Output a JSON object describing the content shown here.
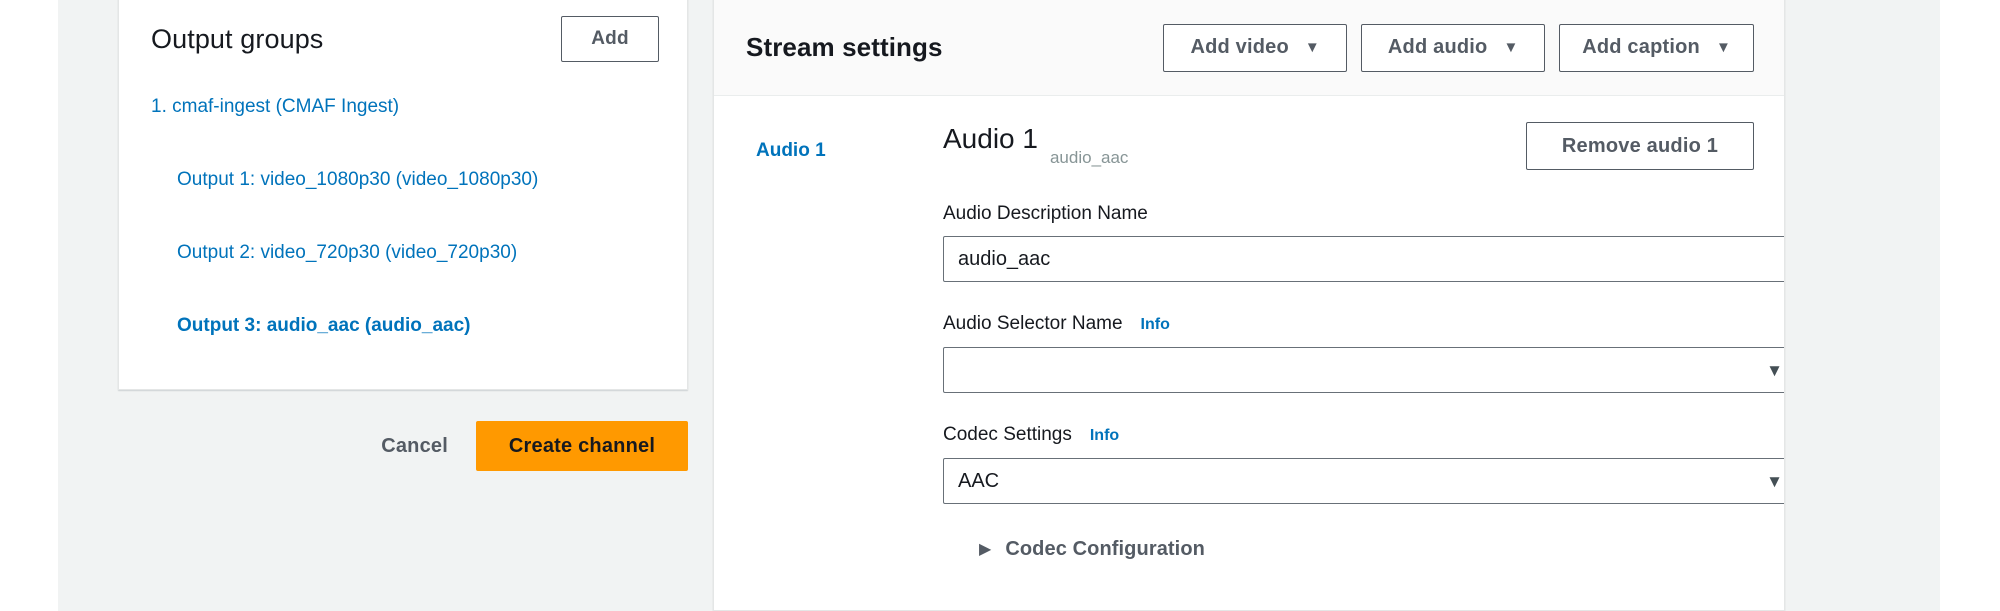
{
  "output_groups": {
    "title": "Output groups",
    "add_button": "Add",
    "groups": [
      {
        "label": "1. cmaf-ingest (CMAF Ingest)",
        "selected": false,
        "outputs": [
          {
            "label": "Output 1: video_1080p30 (video_1080p30)",
            "selected": false
          },
          {
            "label": "Output 2: video_720p30 (video_720p30)",
            "selected": false
          },
          {
            "label": "Output 3: audio_aac (audio_aac)",
            "selected": true
          }
        ]
      }
    ],
    "cancel_button": "Cancel",
    "create_button": "Create channel"
  },
  "stream_settings": {
    "title": "Stream settings",
    "header_buttons": [
      {
        "label": "Add video",
        "icon": "chevron-down-icon",
        "caret": "▼"
      },
      {
        "label": "Add audio",
        "icon": "chevron-down-icon",
        "caret": "▼"
      },
      {
        "label": "Add caption",
        "icon": "chevron-down-icon",
        "caret": "▼"
      }
    ],
    "nav": [
      {
        "label": "Audio 1",
        "selected": true
      }
    ],
    "section": {
      "title": "Audio 1",
      "subtitle": "audio_aac",
      "remove_button": "Remove audio 1"
    },
    "fields": {
      "audio_description_name": {
        "label": "Audio Description Name",
        "value": "audio_aac",
        "placeholder": ""
      },
      "audio_selector_name": {
        "label": "Audio Selector Name",
        "info": "Info",
        "value": "",
        "arrow": "▼"
      },
      "codec_settings": {
        "label": "Codec Settings",
        "info": "Info",
        "value": "AAC",
        "arrow": "▼"
      }
    },
    "expander": {
      "label": "Codec Configuration",
      "triangle": "▶",
      "expanded": false
    }
  },
  "colors": {
    "link": "#0073bb",
    "accent_orange": "#ff9900",
    "text": "#16191f",
    "muted": "#545b64",
    "page_bg": "#f1f3f3",
    "card_bg": "#ffffff",
    "border": "#e4e6e6"
  }
}
